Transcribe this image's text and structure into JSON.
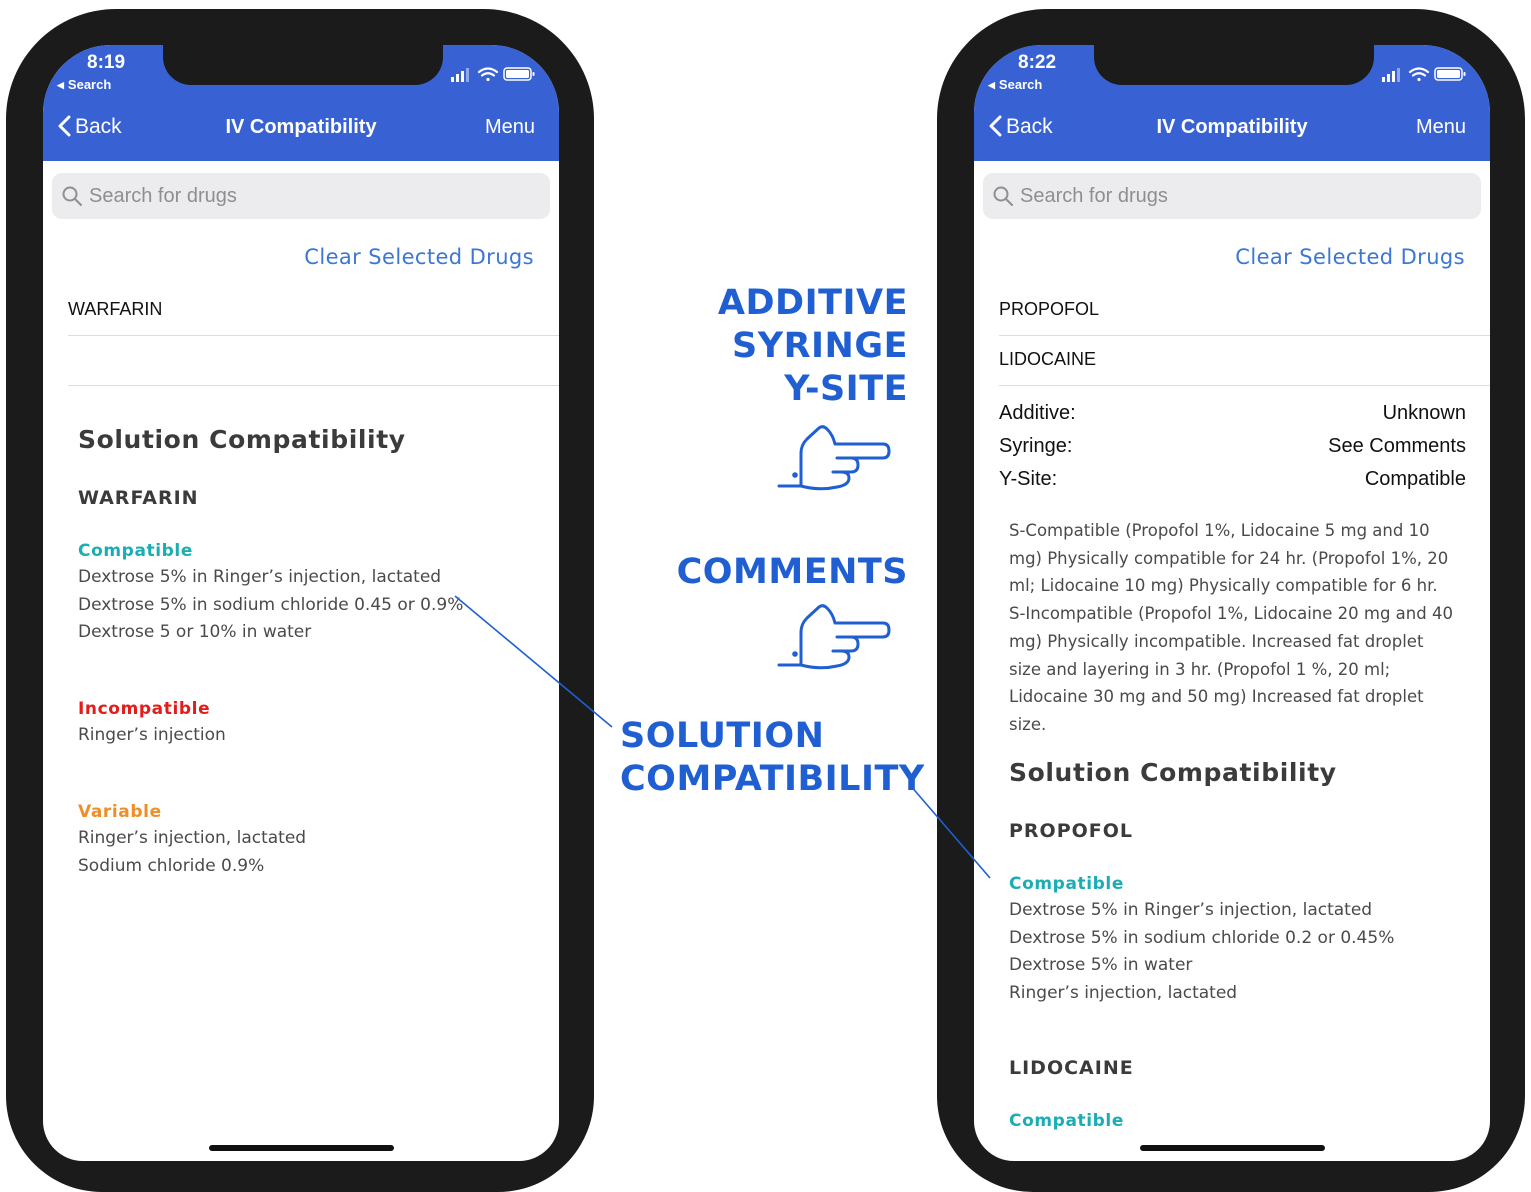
{
  "left_phone": {
    "status": {
      "time": "8:19",
      "back_label": "Search"
    },
    "nav": {
      "back": "Back",
      "title": "IV Compatibility",
      "menu": "Menu"
    },
    "search": {
      "placeholder": "Search for drugs"
    },
    "clear_label": "Clear Selected Drugs",
    "selected_drugs": [
      "WARFARIN",
      ""
    ],
    "section_title": "Solution Compatibility",
    "drug": {
      "name": "WARFARIN",
      "compatible_label": "Compatible",
      "compatible": [
        "Dextrose 5% in Ringer’s injection, lactated",
        "Dextrose 5% in sodium chloride 0.45 or 0.9%",
        "Dextrose 5 or 10% in water"
      ],
      "incompatible_label": "Incompatible",
      "incompatible": [
        "Ringer’s injection"
      ],
      "variable_label": "Variable",
      "variable": [
        "Ringer’s injection, lactated",
        "Sodium chloride 0.9%"
      ]
    }
  },
  "right_phone": {
    "status": {
      "time": "8:22",
      "back_label": "Search"
    },
    "nav": {
      "back": "Back",
      "title": "IV Compatibility",
      "menu": "Menu"
    },
    "search": {
      "placeholder": "Search for drugs"
    },
    "clear_label": "Clear Selected Drugs",
    "selected_drugs": [
      "PROPOFOL",
      "LIDOCAINE"
    ],
    "compat": [
      {
        "label": "Additive:",
        "value": "Unknown"
      },
      {
        "label": "Syringe:",
        "value": "See Comments"
      },
      {
        "label": "Y-Site:",
        "value": "Compatible"
      }
    ],
    "comments": "S-Compatible (Propofol 1%, Lidocaine 5 mg and 10 mg) Physically compatible for 24 hr. (Propofol 1%, 20 ml; Lidocaine 10 mg) Physically compatible for 6 hr. S-Incompatible (Propofol 1%, Lidocaine 20 mg and 40 mg) Physically incompatible. Increased fat droplet size and layering in 3 hr. (Propofol 1 %, 20 ml; Lidocaine 30 mg and 50 mg) Increased fat droplet size.",
    "section_title": "Solution Compatibility",
    "drug1": {
      "name": "PROPOFOL",
      "compatible_label": "Compatible",
      "compatible": [
        "Dextrose 5% in Ringer’s injection, lactated",
        "Dextrose 5% in sodium chloride 0.2 or 0.45%",
        "Dextrose 5% in water",
        "Ringer’s injection, lactated"
      ]
    },
    "drug2": {
      "name": "LIDOCAINE",
      "compatible_label": "Compatible"
    }
  },
  "callouts": {
    "additive": [
      "ADDITIVE",
      "SYRINGE",
      "Y-SITE"
    ],
    "comments": "COMMENTS",
    "solution": [
      "SOLUTION",
      "COMPATIBILITY"
    ]
  },
  "colors": {
    "brand_blue": "#3862d3",
    "callout_blue": "#1f5fd1",
    "compatible": "#1aaeb4",
    "incompatible": "#e31c1c",
    "variable": "#ef8e24"
  },
  "icons": [
    "chevron-left-icon",
    "search-icon",
    "signal-icon",
    "wifi-icon",
    "battery-icon",
    "pointing-hand-icon"
  ]
}
